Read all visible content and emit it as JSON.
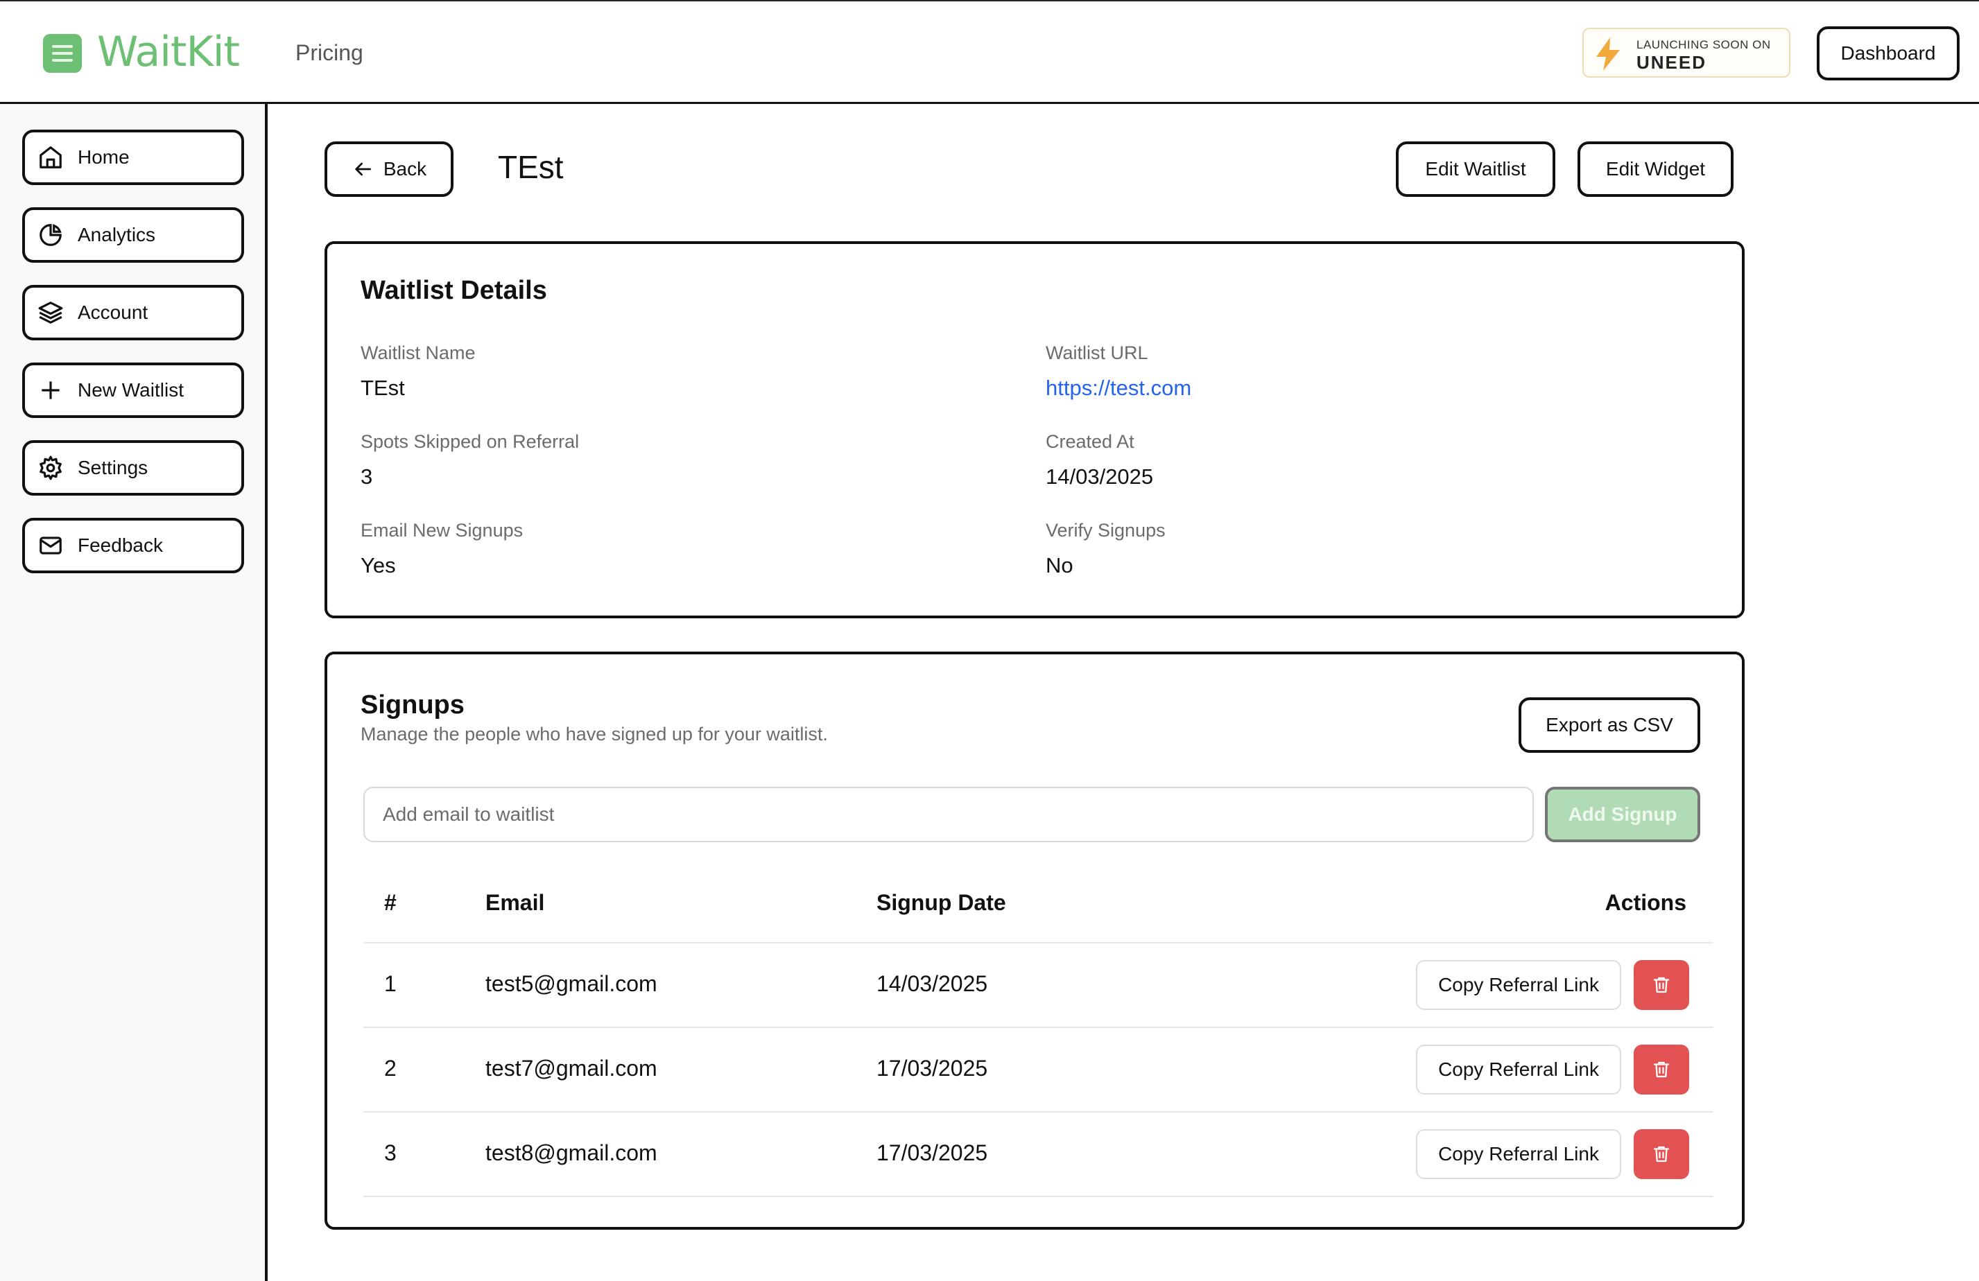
{
  "header": {
    "brand": "WaitKit",
    "nav_pricing": "Pricing",
    "badge_line1": "LAUNCHING SOON ON",
    "badge_line2": "UNEED",
    "dashboard_label": "Dashboard"
  },
  "sidebar": {
    "items": [
      {
        "label": "Home",
        "icon": "home-icon"
      },
      {
        "label": "Analytics",
        "icon": "pie-chart-icon"
      },
      {
        "label": "Account",
        "icon": "layers-icon"
      },
      {
        "label": "New Waitlist",
        "icon": "plus-icon"
      },
      {
        "label": "Settings",
        "icon": "gear-icon"
      },
      {
        "label": "Feedback",
        "icon": "mail-icon"
      }
    ]
  },
  "toolbar": {
    "back_label": "Back",
    "title": "TEst",
    "edit_waitlist_label": "Edit Waitlist",
    "edit_widget_label": "Edit Widget"
  },
  "details": {
    "title": "Waitlist Details",
    "name_label": "Waitlist Name",
    "name_value": "TEst",
    "url_label": "Waitlist URL",
    "url_value": "https://test.com",
    "spots_label": "Spots Skipped on Referral",
    "spots_value": "3",
    "created_label": "Created At",
    "created_value": "14/03/2025",
    "email_label": "Email New Signups",
    "email_value": "Yes",
    "verify_label": "Verify Signups",
    "verify_value": "No"
  },
  "signups": {
    "title": "Signups",
    "subtitle": "Manage the people who have signed up for your waitlist.",
    "export_label": "Export as CSV",
    "input_placeholder": "Add email to waitlist",
    "add_label": "Add Signup",
    "columns": [
      "#",
      "Email",
      "Signup Date",
      "Actions"
    ],
    "rows": [
      {
        "num": "1",
        "email": "test5@gmail.com",
        "date": "14/03/2025",
        "action": "Copy Referral Link"
      },
      {
        "num": "2",
        "email": "test7@gmail.com",
        "date": "17/03/2025",
        "action": "Copy Referral Link"
      },
      {
        "num": "3",
        "email": "test8@gmail.com",
        "date": "17/03/2025",
        "action": "Copy Referral Link"
      }
    ]
  },
  "colors": {
    "brand_green": "#6dbf73",
    "add_button_disabled": "#b1dbb5",
    "delete_red": "#e25252",
    "link_blue": "#2563eb"
  }
}
